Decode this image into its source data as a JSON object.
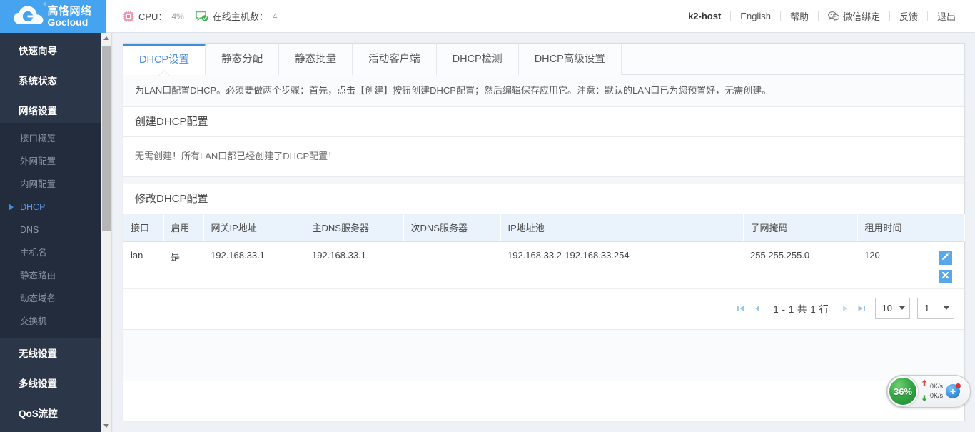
{
  "brand": {
    "name_cn": "高恪网络",
    "name_en": "Gocloud",
    "registered_mark": "®",
    "logo_icon": "cloud-logo-icon"
  },
  "header": {
    "stats": [
      {
        "icon": "cpu-icon",
        "label": "CPU：",
        "value": "4%"
      },
      {
        "icon": "online-host-icon",
        "label": "在线主机数：",
        "value": "4"
      }
    ],
    "right_items": [
      {
        "key": "host",
        "label": "k2-host",
        "icon": ""
      },
      {
        "key": "language",
        "label": "English",
        "icon": ""
      },
      {
        "key": "help",
        "label": "帮助",
        "icon": ""
      },
      {
        "key": "wechat",
        "label": "微信绑定",
        "icon": "wechat-icon"
      },
      {
        "key": "feedback",
        "label": "反馈",
        "icon": ""
      },
      {
        "key": "logout",
        "label": "退出",
        "icon": ""
      }
    ]
  },
  "sidebar": {
    "groups": [
      {
        "label": "快速向导",
        "type": "group"
      },
      {
        "label": "系统状态",
        "type": "group"
      },
      {
        "label": "网络设置",
        "type": "group",
        "expanded": true
      }
    ],
    "sub_items": [
      {
        "label": "接口概览",
        "active": false
      },
      {
        "label": "外网配置",
        "active": false
      },
      {
        "label": "内网配置",
        "active": false
      },
      {
        "label": "DHCP",
        "active": true
      },
      {
        "label": "DNS",
        "active": false
      },
      {
        "label": "主机名",
        "active": false
      },
      {
        "label": "静态路由",
        "active": false
      },
      {
        "label": "动态域名",
        "active": false
      },
      {
        "label": "交换机",
        "active": false
      }
    ],
    "bottom_groups": [
      {
        "label": "无线设置"
      },
      {
        "label": "多线设置"
      },
      {
        "label": "QoS流控"
      }
    ]
  },
  "tabs": [
    {
      "label": "DHCP设置",
      "active": true
    },
    {
      "label": "静态分配",
      "active": false
    },
    {
      "label": "静态批量",
      "active": false
    },
    {
      "label": "活动客户端",
      "active": false
    },
    {
      "label": "DHCP检测",
      "active": false
    },
    {
      "label": "DHCP高级设置",
      "active": false
    }
  ],
  "notice": "为LAN口配置DHCP。必须要做两个步骤：首先，点击【创建】按钮创建DHCP配置；然后编辑保存应用它。注意：默认的LAN口已为您预置好，无需创建。",
  "create_section": {
    "title": "创建DHCP配置",
    "message": "无需创建！所有LAN口都已经创建了DHCP配置！"
  },
  "modify_section": {
    "title": "修改DHCP配置",
    "columns": [
      "接口",
      "启用",
      "网关IP地址",
      "主DNS服务器",
      "次DNS服务器",
      "IP地址池",
      "子网掩码",
      "租用时间",
      ""
    ],
    "rows": [
      {
        "interface": "lan",
        "enabled": "是",
        "gateway_ip": "192.168.33.1",
        "primary_dns": "192.168.33.1",
        "secondary_dns": "",
        "ip_pool": "192.168.33.2-192.168.33.254",
        "netmask": "255.255.255.0",
        "lease_time": "120",
        "actions": [
          {
            "name": "edit-row-button",
            "icon": "pencil-icon"
          },
          {
            "name": "delete-row-button",
            "icon": "close-x-icon"
          }
        ]
      }
    ]
  },
  "pager": {
    "first_icon": "first-page-icon",
    "prev_icon": "prev-page-icon",
    "next_icon": "next-page-icon",
    "last_icon": "last-page-icon",
    "range_label": "1 - 1 共 1 行",
    "page_size": "10",
    "page_number": "1"
  },
  "float_widget": {
    "percent": "36%",
    "upload_rate": "0K/s",
    "download_rate": "0K/s",
    "up_icon": "arrow-up-icon",
    "down_icon": "arrow-down-icon",
    "add_icon": "plus-badge-icon"
  },
  "colors": {
    "brand_blue": "#46a3f0",
    "sidebar_bg": "#2b3648",
    "sidebar_sub_bg": "#222c3c",
    "tab_active": "#4b8ed6",
    "table_header_bg": "#eaf3fb",
    "action_button": "#58a7e8",
    "widget_green": "#35a845"
  }
}
